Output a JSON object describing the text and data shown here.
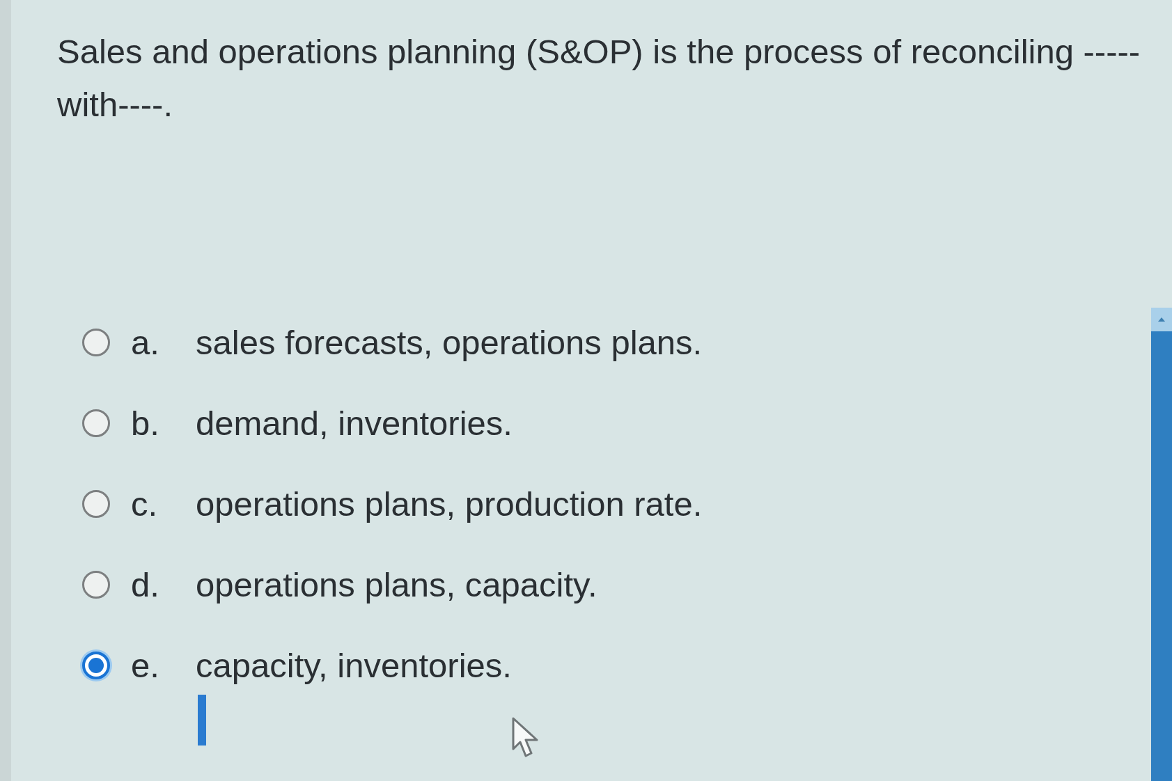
{
  "question": {
    "text": "Sales and operations planning (S&OP) is the process of reconciling ----- with----."
  },
  "options": [
    {
      "letter": "a.",
      "text": "sales forecasts, operations plans.",
      "selected": false
    },
    {
      "letter": "b.",
      "text": "demand, inventories.",
      "selected": false
    },
    {
      "letter": "c.",
      "text": "operations plans, production rate.",
      "selected": false
    },
    {
      "letter": "d.",
      "text": "operations plans, capacity.",
      "selected": false
    },
    {
      "letter": "e.",
      "text": "capacity, inventories.",
      "selected": true
    }
  ]
}
